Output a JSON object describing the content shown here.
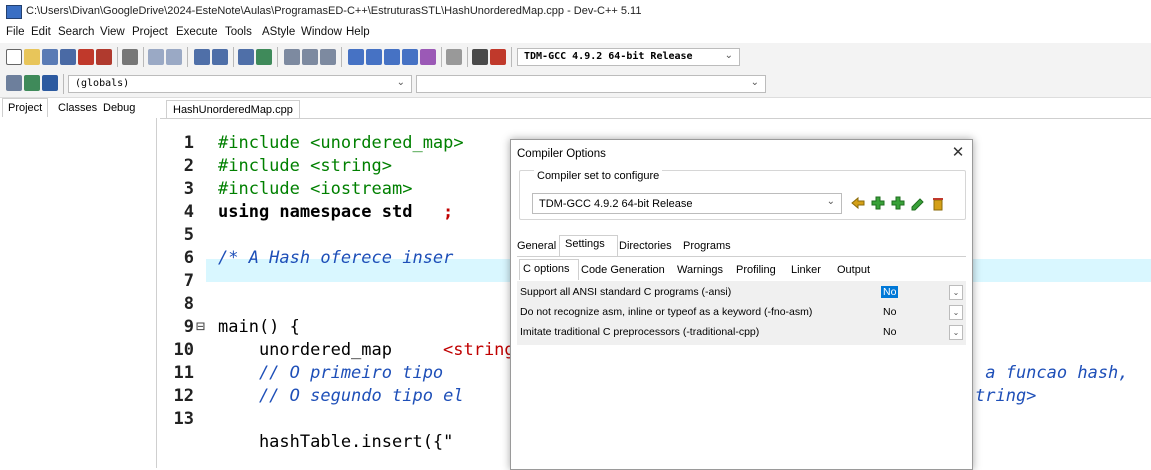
{
  "window": {
    "title": "C:\\Users\\Divan\\GoogleDrive\\2024-EsteNote\\Aulas\\ProgramasED-C++\\EstruturasSTL\\HashUnorderedMap.cpp - Dev-C++ 5.11"
  },
  "menu": [
    "File",
    "Edit",
    "Search",
    "View",
    "Project",
    "Execute",
    "Tools",
    "AStyle",
    "Window",
    "Help"
  ],
  "toolbar": {
    "compiler_combo": "TDM-GCC 4.9.2 64-bit Release",
    "scope_combo": "(globals)"
  },
  "left_panel": {
    "tabs": [
      "Project",
      "Classes",
      "Debug"
    ]
  },
  "editor": {
    "file_tab": "HashUnorderedMap.cpp",
    "line_numbers": [
      "1",
      "2",
      "3",
      "4",
      "5",
      "6",
      "7",
      "8",
      "9",
      "10",
      "11",
      "12",
      "13"
    ],
    "lines": [
      "#include <unordered_map>",
      "#include <string>",
      "#include <iostream>",
      "using namespace std",
      ";",
      "/* A Hash oferece inser",
      "main() {",
      "    unordered_map",
      "<string",
      "    // O primeiro tipo ",
      "    // O segundo tipo el",
      "    hashTable.insert({\"",
      " a funcao hash,",
      "tring>",
      "⊟"
    ]
  },
  "dialog": {
    "title": "Compiler Options",
    "close": "✕",
    "group_label": "Compiler set to configure",
    "compiler_set": "TDM-GCC 4.9.2 64-bit Release",
    "tabs": [
      "General",
      "Settings",
      "Directories",
      "Programs"
    ],
    "subtabs": [
      "C options",
      "Code Generation",
      "Warnings",
      "Profiling",
      "Linker",
      "Output"
    ],
    "options": [
      {
        "label": "Support all ANSI standard C programs (-ansi)",
        "value": "No"
      },
      {
        "label": "Do not recognize asm, inline or typeof as a keyword (-fno-asm)",
        "value": "No"
      },
      {
        "label": "Imitate traditional C preprocessors (-traditional-cpp)",
        "value": "No"
      }
    ]
  },
  "colors": {
    "highlight_line": "#d9f7ff",
    "include_green": "#008000",
    "comment_blue": "#1e4fb8",
    "selection_blue": "#0078d7"
  }
}
